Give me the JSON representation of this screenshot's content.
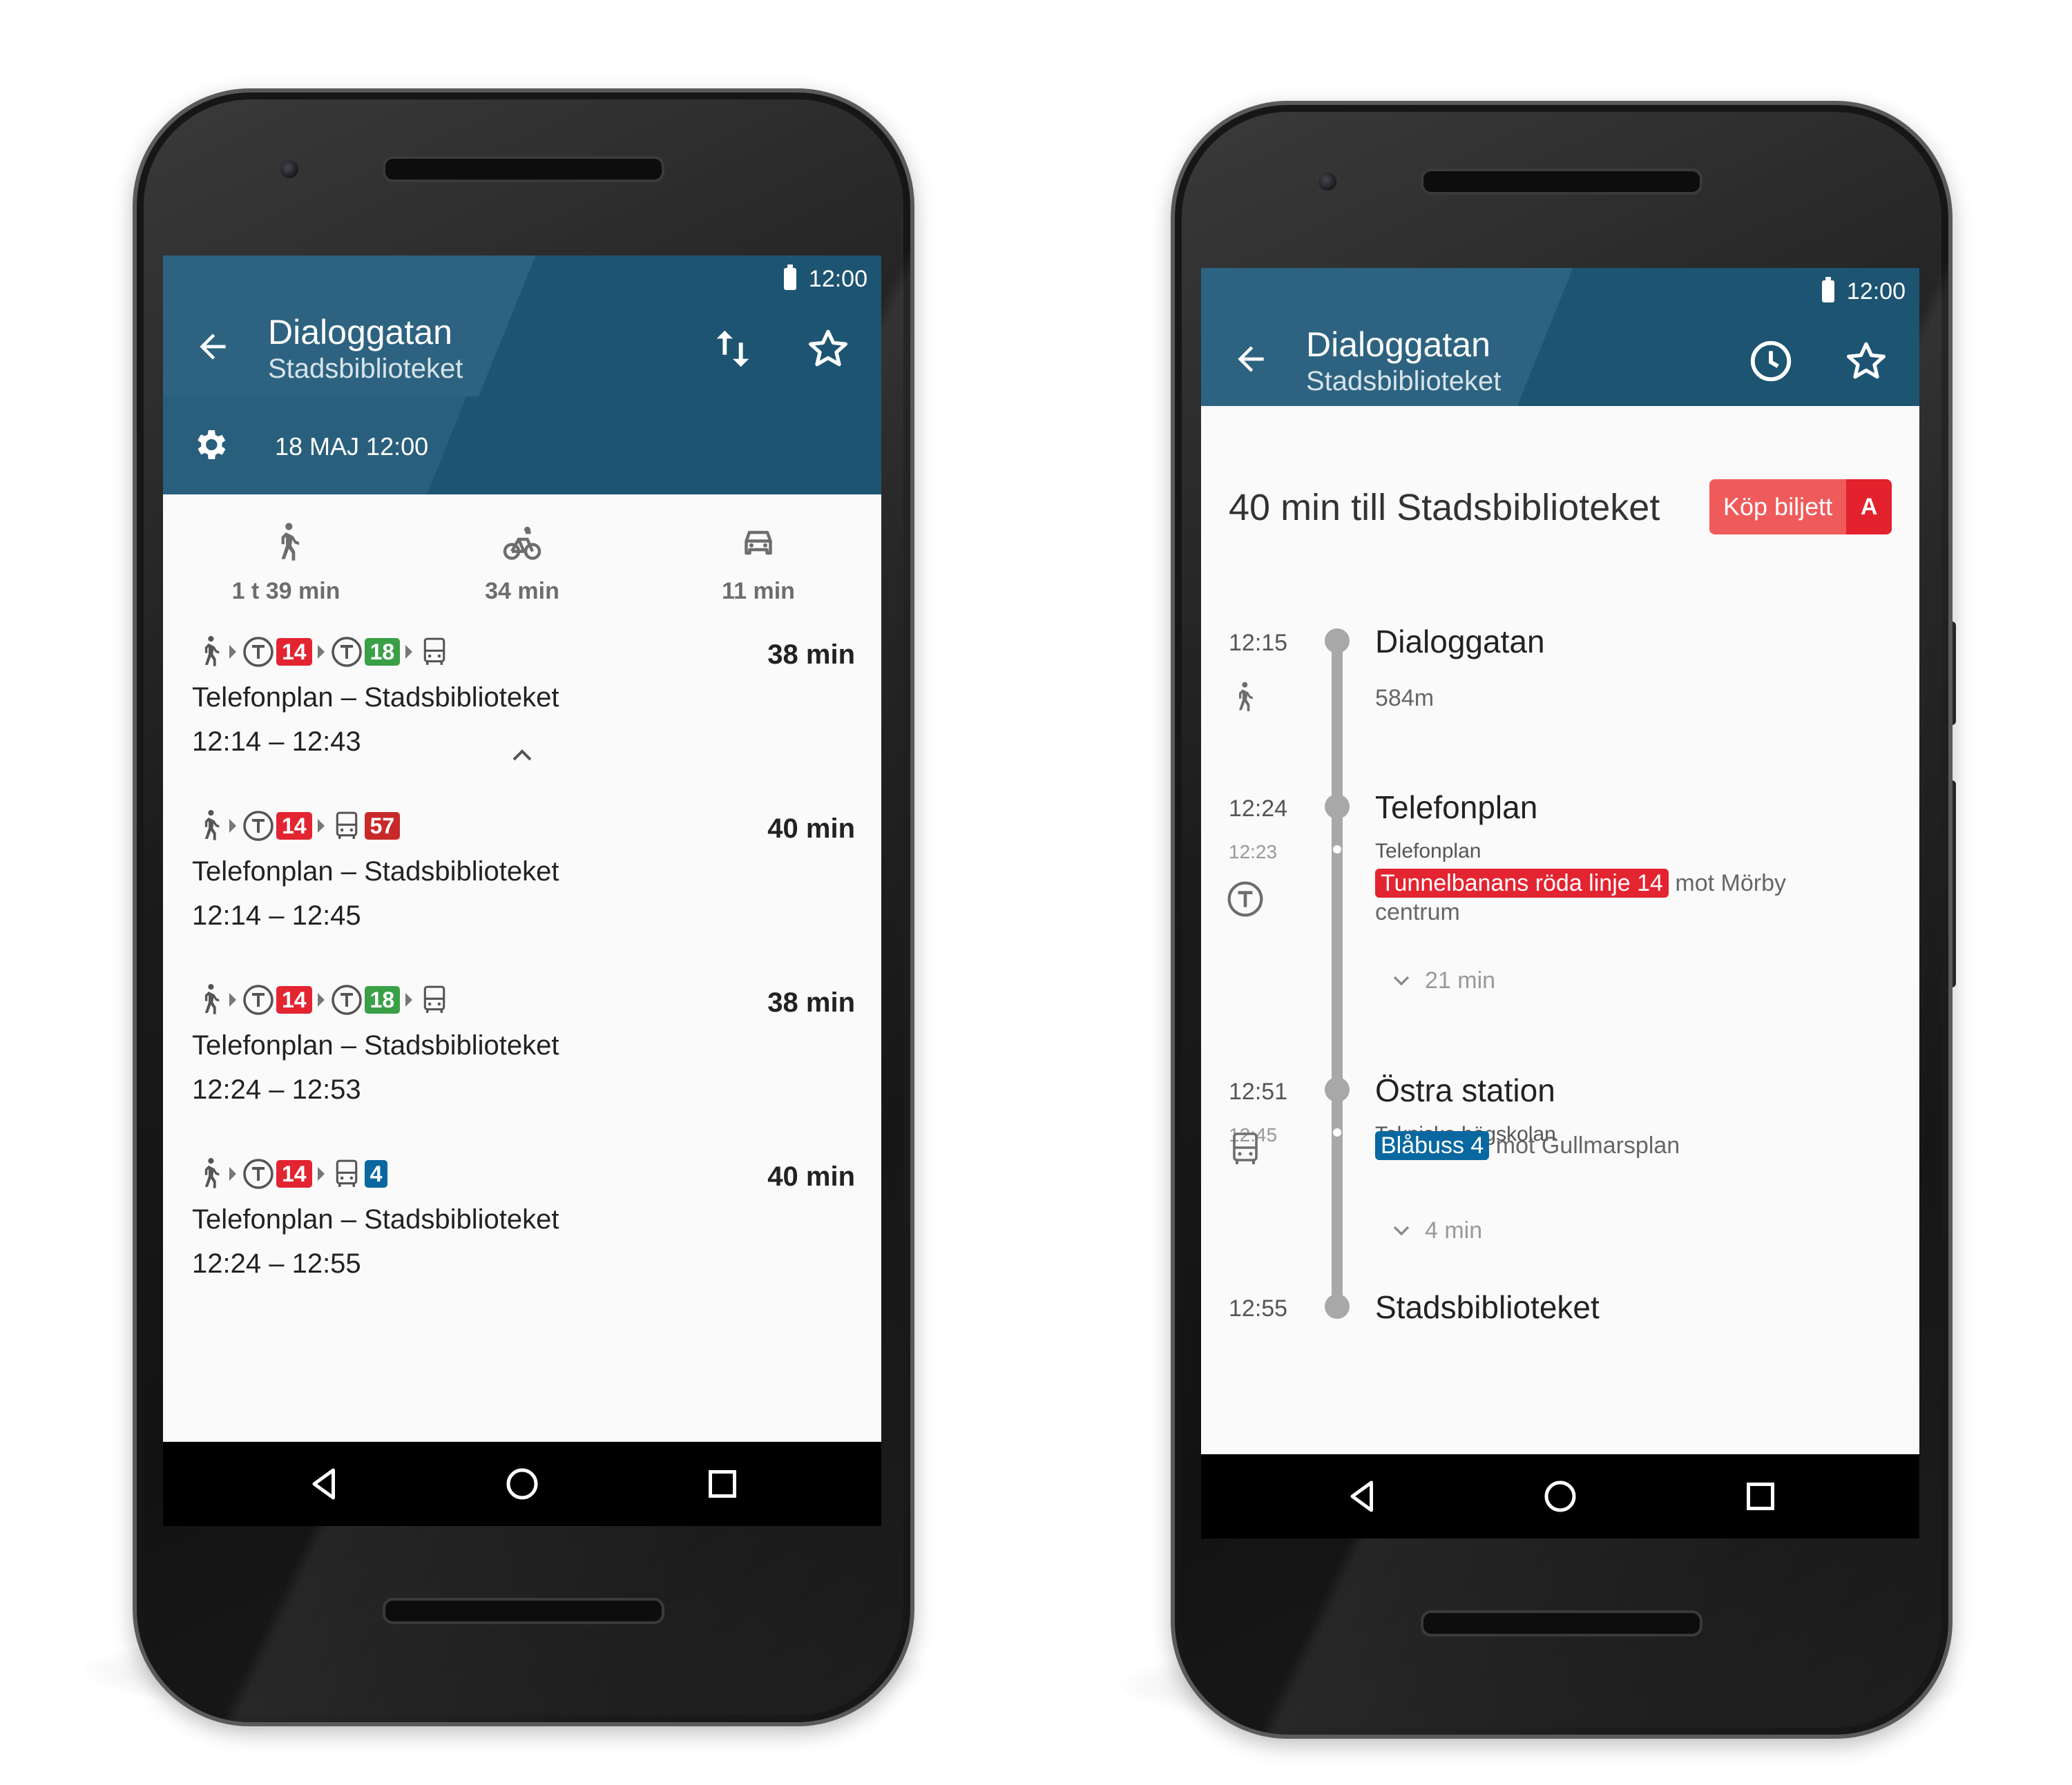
{
  "colors": {
    "appbar": "#1d5472",
    "subway_red": "#e32431",
    "subway_green": "#3aa046",
    "bus_red": "#c82a2a",
    "bus_blue": "#0a68a0",
    "ticket_light": "#ef5b5b",
    "ticket_dark": "#e3222d"
  },
  "left": {
    "status_time": "12:00",
    "title": "Dialoggatan",
    "subtitle": "Stadsbiblioteket",
    "date_label": "18 MAJ 12:00",
    "modes": [
      {
        "icon": "walk-icon",
        "label": "1 t 39 min"
      },
      {
        "icon": "bike-icon",
        "label": "34 min"
      },
      {
        "icon": "car-icon",
        "label": "11 min"
      }
    ],
    "trips": [
      {
        "legs": [
          "walk",
          "subway:14:red",
          "subway:18:green",
          "bus"
        ],
        "duration": "38 min",
        "stops": "Telefonplan – Stadsbiblioteket",
        "times": "12:14 – 12:43"
      },
      {
        "legs": [
          "walk",
          "subway:14:red",
          "bus:57:darkred"
        ],
        "duration": "40 min",
        "stops": "Telefonplan – Stadsbiblioteket",
        "times": "12:14 – 12:45"
      },
      {
        "legs": [
          "walk",
          "subway:14:red",
          "subway:18:green",
          "bus"
        ],
        "duration": "38 min",
        "stops": "Telefonplan – Stadsbiblioteket",
        "times": "12:24 – 12:53"
      },
      {
        "legs": [
          "walk",
          "subway:14:red",
          "bus:4:blue"
        ],
        "duration": "40 min",
        "stops": "Telefonplan – Stadsbiblioteket",
        "times": "12:24 – 12:55"
      }
    ]
  },
  "right": {
    "status_time": "12:00",
    "title": "Dialoggatan",
    "subtitle": "Stadsbiblioteket",
    "headline": "40 min till Stadsbiblioteket",
    "buy_label": "Köp biljett",
    "zone": "A",
    "timeline": {
      "t1": "12:15",
      "s1": "Dialoggatan",
      "walk_dist": "584m",
      "t2": "12:23",
      "s2": "Telefonplan",
      "t3": "12:24",
      "s3": "Telefonplan",
      "line1": "Tunnelbanans röda linje 14",
      "dir1": "mot Mörby centrum",
      "dur1": "21 min",
      "t4": "12:45",
      "s4": "Tekniska högskolan",
      "t5": "12:51",
      "s5": "Östra station",
      "line2": "Blåbuss 4",
      "dir2": "mot Gullmarsplan",
      "dur2": "4 min",
      "t6": "12:55",
      "s6": "Stadsbiblioteket"
    }
  }
}
